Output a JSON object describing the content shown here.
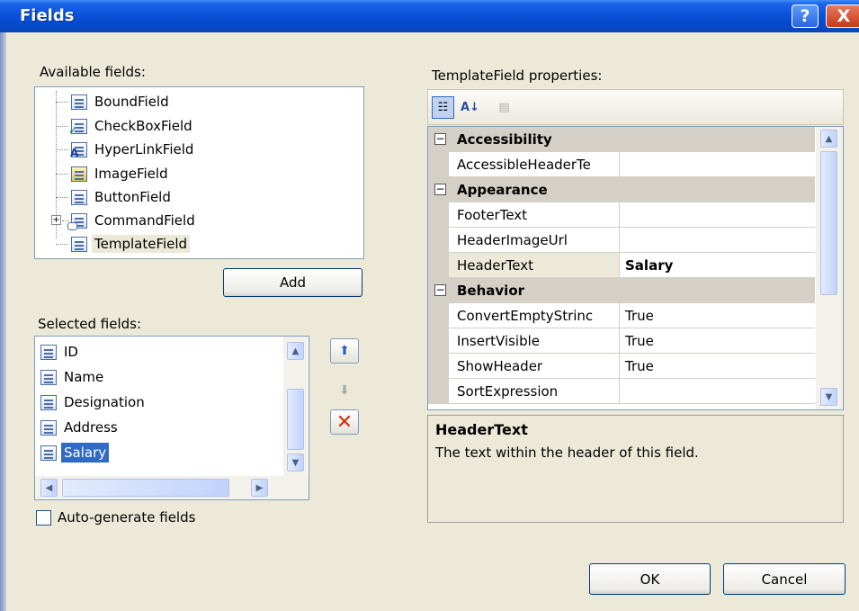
{
  "window": {
    "title": "Fields",
    "help_label": "?",
    "close_label": "X"
  },
  "available": {
    "label": "Available fields:",
    "items": [
      {
        "label": "BoundField",
        "icon": "boundfield-icon"
      },
      {
        "label": "CheckBoxField",
        "icon": "checkboxfield-icon"
      },
      {
        "label": "HyperLinkField",
        "icon": "hyperlinkfield-icon"
      },
      {
        "label": "ImageField",
        "icon": "imagefield-icon"
      },
      {
        "label": "ButtonField",
        "icon": "buttonfield-icon"
      },
      {
        "label": "CommandField",
        "icon": "commandfield-icon"
      },
      {
        "label": "TemplateField",
        "icon": "templatefield-icon",
        "selected": true
      }
    ],
    "add_label": "Add"
  },
  "selected": {
    "label": "Selected fields:",
    "items": [
      {
        "label": "ID"
      },
      {
        "label": "Name"
      },
      {
        "label": "Designation"
      },
      {
        "label": "Address"
      },
      {
        "label": "Salary",
        "selected": true
      }
    ]
  },
  "autogen": {
    "label": "Auto-generate fields",
    "checked": false
  },
  "properties": {
    "label": "TemplateField properties:",
    "rows": [
      {
        "type": "category",
        "name": "Accessibility"
      },
      {
        "type": "prop",
        "name": "AccessibleHeaderTe",
        "value": ""
      },
      {
        "type": "category",
        "name": "Appearance"
      },
      {
        "type": "prop",
        "name": "FooterText",
        "value": ""
      },
      {
        "type": "prop",
        "name": "HeaderImageUrl",
        "value": ""
      },
      {
        "type": "prop",
        "name": "HeaderText",
        "value": "Salary",
        "selected": true
      },
      {
        "type": "category",
        "name": "Behavior"
      },
      {
        "type": "prop",
        "name": "ConvertEmptyStrinc",
        "value": "True"
      },
      {
        "type": "prop",
        "name": "InsertVisible",
        "value": "True"
      },
      {
        "type": "prop",
        "name": "ShowHeader",
        "value": "True"
      },
      {
        "type": "prop",
        "name": "SortExpression",
        "value": ""
      }
    ],
    "description": {
      "title": "HeaderText",
      "text": "The text within the header of this field."
    }
  },
  "buttons": {
    "ok": "OK",
    "cancel": "Cancel"
  },
  "colors": {
    "title_bar": "#0a52d8",
    "selection": "#316ac5",
    "dialog_bg": "#ece9d8"
  }
}
